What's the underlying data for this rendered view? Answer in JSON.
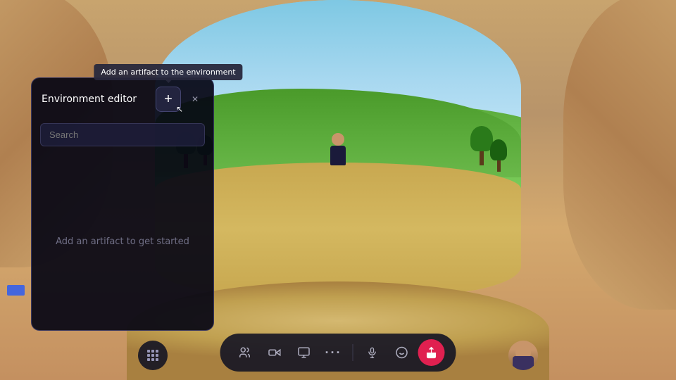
{
  "scene": {
    "background_description": "3D virtual environment with sandy arches and a window to outdoors"
  },
  "tooltip": {
    "text": "Add an artifact to the environment"
  },
  "panel": {
    "title": "Environment editor",
    "search_placeholder": "Search",
    "empty_state": "Add an artifact to get started",
    "add_button_label": "+",
    "close_button_label": "✕"
  },
  "toolbar": {
    "buttons": [
      {
        "id": "people",
        "label": "👥",
        "active": false
      },
      {
        "id": "video",
        "label": "🎬",
        "active": false
      },
      {
        "id": "screen",
        "label": "🖥",
        "active": false
      },
      {
        "id": "more",
        "label": "•••",
        "active": false
      },
      {
        "id": "mic",
        "label": "🎤",
        "active": false
      },
      {
        "id": "emoji",
        "label": "🙂",
        "active": false
      },
      {
        "id": "share",
        "label": "⬡",
        "active": true
      }
    ],
    "grid_button_label": "⊞",
    "avatar_label": "avatar"
  }
}
